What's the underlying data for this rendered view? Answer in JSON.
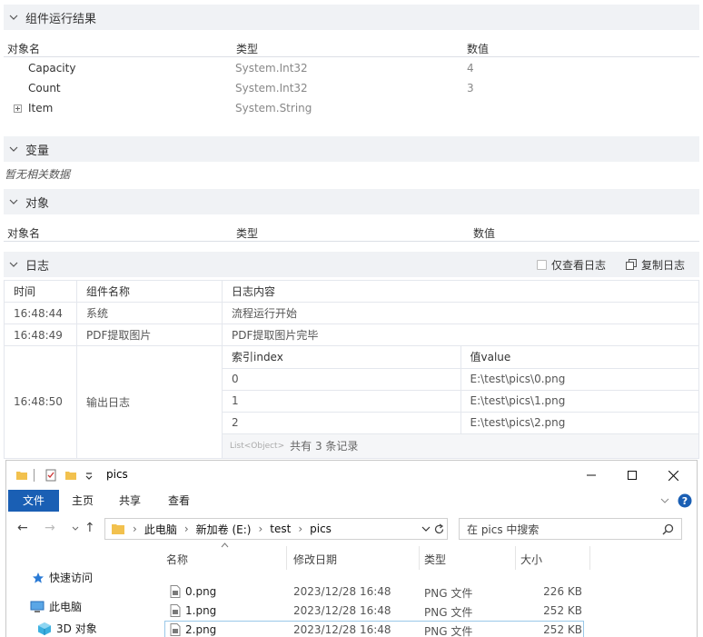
{
  "results": {
    "title": "组件运行结果",
    "columns": [
      "对象名",
      "类型",
      "数值"
    ],
    "rows": [
      {
        "name": "Capacity",
        "type": "System.Int32",
        "value": "4"
      },
      {
        "name": "Count",
        "type": "System.Int32",
        "value": "3"
      },
      {
        "name": "Item",
        "type": "System.String",
        "value": ""
      }
    ]
  },
  "variables": {
    "title": "变量",
    "empty_text": "暂无相关数据"
  },
  "objects": {
    "title": "对象",
    "columns": [
      "对象名",
      "类型",
      "数值"
    ]
  },
  "log": {
    "title": "日志",
    "only_view_label": "仅查看日志",
    "copy_label": "复制日志",
    "columns": [
      "时间",
      "组件名称",
      "日志内容"
    ],
    "rows": [
      {
        "time": "16:48:44",
        "component": "系统",
        "content": "流程运行开始"
      },
      {
        "time": "16:48:49",
        "component": "PDF提取图片",
        "content": "PDF提取图片完毕"
      },
      {
        "time": "16:48:50",
        "component": "输出日志"
      }
    ],
    "list": {
      "headers": [
        "索引index",
        "值value"
      ],
      "rows": [
        {
          "index": "0",
          "value": "E:\\test\\pics\\0.png"
        },
        {
          "index": "1",
          "value": "E:\\test\\pics\\1.png"
        },
        {
          "index": "2",
          "value": "E:\\test\\pics\\2.png"
        }
      ],
      "type_tag": "List<Object>",
      "count_text": "共有 3 条记录"
    }
  },
  "explorer": {
    "window_title": "pics",
    "ribbon_tabs": [
      "文件",
      "主页",
      "共享",
      "查看"
    ],
    "breadcrumb": [
      "此电脑",
      "新加卷 (E:)",
      "test",
      "pics"
    ],
    "search_placeholder": "在 pics 中搜索",
    "nav": [
      "快速访问",
      "此电脑",
      "3D 对象"
    ],
    "columns": [
      "名称",
      "修改日期",
      "类型",
      "大小"
    ],
    "files": [
      {
        "name": "0.png",
        "date": "2023/12/28 16:48",
        "type": "PNG 文件",
        "size": "226 KB"
      },
      {
        "name": "1.png",
        "date": "2023/12/28 16:48",
        "type": "PNG 文件",
        "size": "252 KB"
      },
      {
        "name": "2.png",
        "date": "2023/12/28 16:48",
        "type": "PNG 文件",
        "size": "252 KB"
      }
    ],
    "colors": {
      "accent": "#1a5fb4",
      "folder": "#f2c14e",
      "selection": "#9ac8e8"
    }
  }
}
